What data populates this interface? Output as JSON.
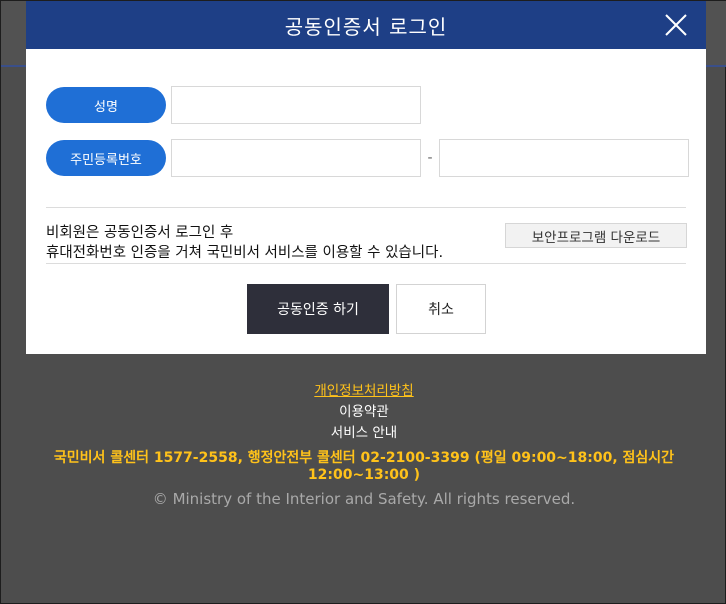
{
  "modal": {
    "title": "공동인증서 로그인",
    "close_icon": "close-icon",
    "name_label": "성명",
    "name_value": "",
    "rrn_label": "주민등록번호",
    "rrn_front_value": "",
    "rrn_separator": "-",
    "rrn_back_value": "",
    "info_line1": "비회원은 공동인증서 로그인 후",
    "info_line2": "휴대전화번호 인증을 거쳐 국민비서 서비스를 이용할 수 있습니다.",
    "download_label": "보안프로그램 다운로드",
    "submit_label": "공동인증 하기",
    "cancel_label": "취소"
  },
  "footer": {
    "privacy_label": "개인정보처리방침",
    "terms_label": "이용약관",
    "service_label": "서비스 안내",
    "callcenter_text": "국민비서 콜센터 1577-2558, 행정안전부 콜센터 02-2100-3399 (평일 09:00~18:00, 점심시간 12:00~13:00 )",
    "copyright_text": "© Ministry of the Interior and Safety. All rights reserved."
  },
  "colors": {
    "header_blue": "#1e3f86",
    "pill_blue": "#1f6fd6",
    "primary_button": "#2e2f3a",
    "footer_accent": "#ffc21a",
    "backdrop": "#4d4d4d"
  }
}
